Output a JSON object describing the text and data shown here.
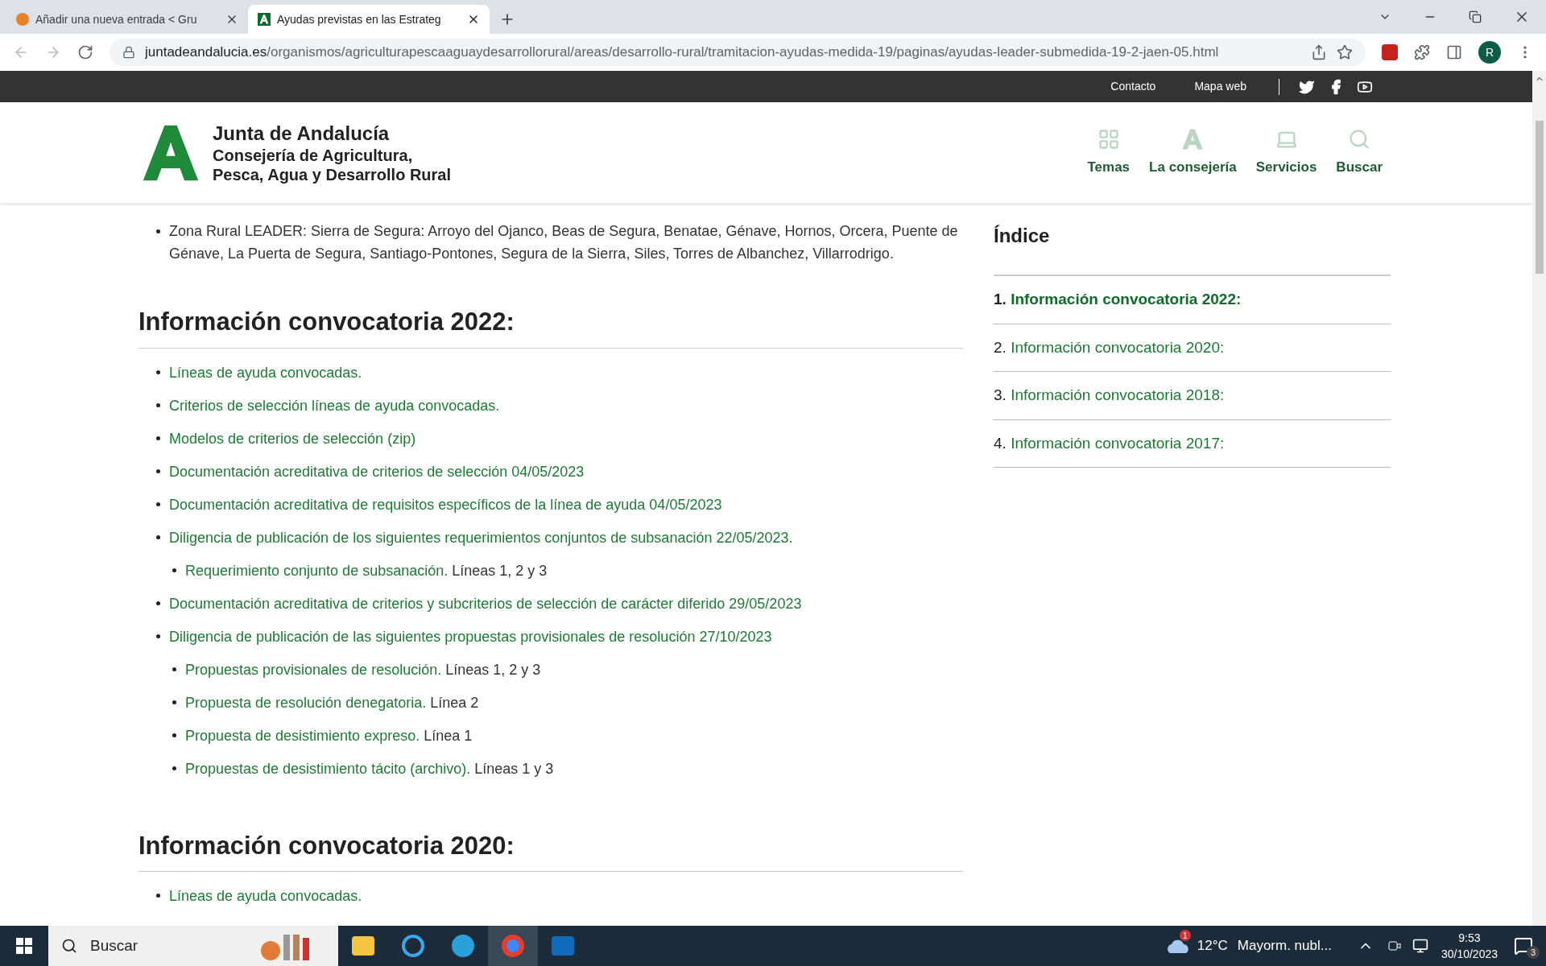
{
  "browser": {
    "tabs": [
      {
        "title": "Añadir una nueva entrada < Gru",
        "selected": false
      },
      {
        "title": "Ayudas previstas en las Estrateg",
        "selected": true
      }
    ],
    "url_host": "juntadeandalucia.es",
    "url_path": "/organismos/agriculturapescaaguaydesarrollorural/areas/desarrollo-rural/tramitacion-ayudas-medida-19/paginas/ayudas-leader-submedida-19-2-jaen-05.html",
    "profile": "R"
  },
  "top_bar": {
    "links": [
      "Contacto",
      "Mapa web"
    ]
  },
  "header": {
    "title": "Junta de Andalucía",
    "subtitle_lines": [
      "Consejería de Agricultura,",
      "Pesca, Agua y Desarrollo Rural"
    ],
    "nav": [
      {
        "kind": "grid",
        "label": "Temas"
      },
      {
        "kind": "logo",
        "label": "La consejería"
      },
      {
        "kind": "laptop",
        "label": "Servicios"
      },
      {
        "kind": "search",
        "label": "Buscar"
      }
    ]
  },
  "content": {
    "intro": "Zona Rural LEADER: Sierra de Segura: Arroyo del Ojanco, Beas de Segura, Benatae, Génave, Hornos, Orcera, Puente de Génave, La Puerta de Segura, Santiago-Pontones, Segura de la Sierra, Siles, Torres de Albanchez, Villarrodrigo.",
    "sections": [
      {
        "heading": "Información convocatoria 2022:",
        "items": [
          {
            "link": "Líneas de ayuda convocadas."
          },
          {
            "link": "Criterios de selección líneas de ayuda convocadas."
          },
          {
            "link": "Modelos de criterios de selección (zip)"
          },
          {
            "link": "Documentación acreditativa de criterios de selección 04/05/2023"
          },
          {
            "link": "Documentación acreditativa de requisitos específicos de la línea de ayuda 04/05/2023"
          },
          {
            "link": "Diligencia de publicación de los siguientes requerimientos conjuntos de subsanación 22/05/2023.",
            "children": [
              {
                "link": "Requerimiento conjunto de subsanación.",
                "text": "Líneas 1, 2 y 3"
              }
            ]
          },
          {
            "link": "Documentación acreditativa de criterios y subcriterios de selección de carácter diferido 29/05/2023"
          },
          {
            "link": "Diligencia de publicación de las siguientes propuestas provisionales de resolución 27/10/2023",
            "children": [
              {
                "link": "Propuestas provisionales de resolución.",
                "text": "Líneas 1, 2 y 3"
              },
              {
                "link": "Propuesta de resolución denegatoria.",
                "text": "Línea 2"
              },
              {
                "link": "Propuesta de desistimiento expreso.",
                "text": "Línea 1"
              },
              {
                "link": "Propuestas de desistimiento tácito (archivo).",
                "text": "Líneas 1 y 3"
              }
            ]
          }
        ]
      },
      {
        "heading": "Información convocatoria 2020:",
        "items": [
          {
            "link": "Líneas de ayuda convocadas."
          }
        ]
      }
    ]
  },
  "index": {
    "title": "Índice",
    "items": [
      {
        "number": "1.",
        "label": "Información convocatoria 2022:",
        "selected": true
      },
      {
        "number": "2.",
        "label": "Información convocatoria 2020:",
        "selected": false
      },
      {
        "number": "3.",
        "label": "Información convocatoria 2018:",
        "selected": false
      },
      {
        "number": "4.",
        "label": "Información convocatoria 2017:",
        "selected": false
      }
    ]
  },
  "taskbar": {
    "search_placeholder": "Buscar",
    "weather_badge": "1",
    "temperature": "12°C",
    "weather": "Mayorm. nubl...",
    "time": "9:53",
    "date": "30/10/2023",
    "notifications": "3"
  }
}
